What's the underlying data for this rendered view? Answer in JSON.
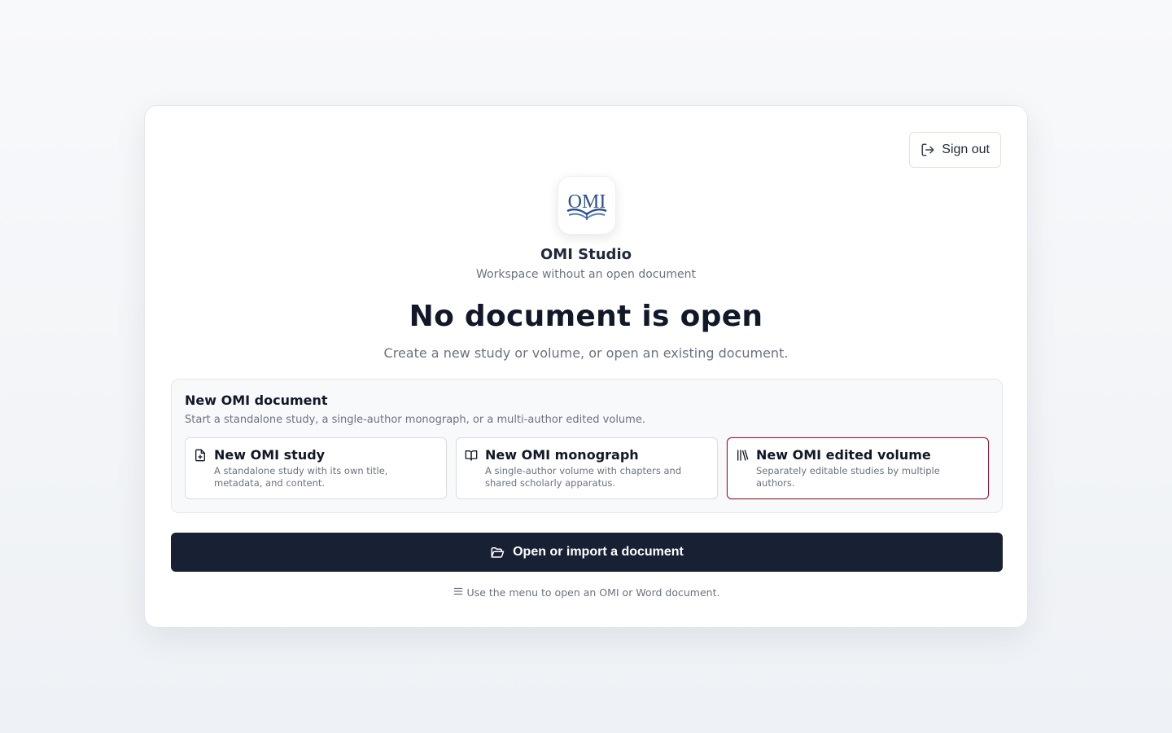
{
  "header": {
    "sign_out_label": "Sign out"
  },
  "brand": {
    "logo_text": "OMI",
    "app_name": "OMI Studio",
    "subtitle": "Workspace without an open document",
    "accent": "#2c4f8a"
  },
  "main": {
    "headline": "No document is open",
    "lead": "Create a new study or volume, or open an existing document."
  },
  "new_document": {
    "title": "New OMI document",
    "description": "Start a standalone study, a single-author monograph, or a multi-author edited volume.",
    "options": [
      {
        "icon": "file-plus-icon",
        "title": "New OMI study",
        "description": "A standalone study with its own title, metadata, and content."
      },
      {
        "icon": "book-open-icon",
        "title": "New OMI monograph",
        "description": "A single-author volume with chapters and shared scholarly apparatus."
      },
      {
        "icon": "library-icon",
        "title": "New OMI edited volume",
        "description": "Separately editable studies by multiple authors.",
        "selected": true
      }
    ]
  },
  "open": {
    "button_label": "Open or import a document",
    "hint": "Use the menu to open an OMI or Word document."
  },
  "colors": {
    "primary_button": "#182033",
    "selected_border": "#8a1c3a"
  }
}
